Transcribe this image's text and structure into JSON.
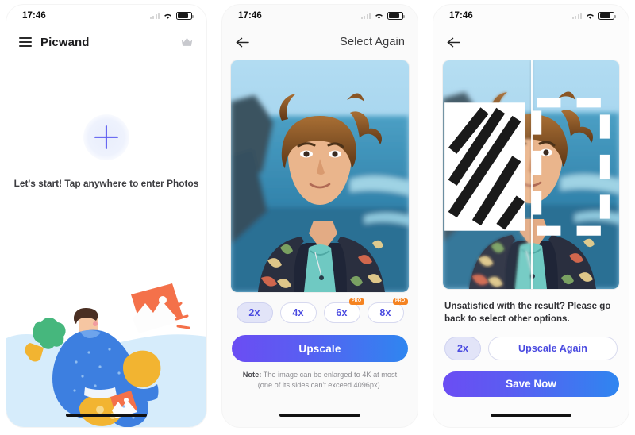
{
  "panels": [
    {
      "status": {
        "time": "17:46"
      },
      "nav": {
        "title": "Picwand",
        "menu_icon": "hamburger-menu-icon",
        "premium_icon": "crown-icon"
      },
      "body": {
        "add_icon": "plus-icon",
        "hint": "Let's start! Tap anywhere to enter Photos",
        "illustration": "person-with-photos-illustration"
      }
    },
    {
      "status": {
        "time": "17:46"
      },
      "nav": {
        "back_icon": "back-arrow-icon",
        "action_label": "Select Again"
      },
      "photo": {
        "alt": "portrait-photo-preview"
      },
      "scales": [
        {
          "label": "2x",
          "selected": true,
          "pro": false,
          "pro_label": ""
        },
        {
          "label": "4x",
          "selected": false,
          "pro": false,
          "pro_label": ""
        },
        {
          "label": "6x",
          "selected": false,
          "pro": true,
          "pro_label": "PRO"
        },
        {
          "label": "8x",
          "selected": false,
          "pro": true,
          "pro_label": "PRO"
        }
      ],
      "primary_button": "Upscale",
      "note": {
        "prefix": "Note:",
        "line1": " The image can be enlarged to 4K at most",
        "line2": "(one of its sides can't exceed 4096px)."
      }
    },
    {
      "status": {
        "time": "17:46"
      },
      "nav": {
        "back_icon": "back-arrow-icon"
      },
      "photo": {
        "alt": "before-after-comparison-photo",
        "compare_icon": "compare-split-icon"
      },
      "message": "Unsatisfied with the result? Please go back to select other options.",
      "scale_chip": "2x",
      "secondary_button": "Upscale Again",
      "primary_button": "Save Now"
    }
  ],
  "colors": {
    "accent_blue": "#4a4ae0",
    "chip_selected_bg": "#e2e4f8",
    "pro_badge": "#f58321",
    "gradient_start": "#6b4df3",
    "gradient_end": "#2f86f0",
    "illustration_blue": "#3d7fe0",
    "illustration_yellow": "#f2b431",
    "illustration_orange": "#f4714a",
    "illustration_green": "#46b77d",
    "illustration_bg": "#d6ecfb"
  }
}
